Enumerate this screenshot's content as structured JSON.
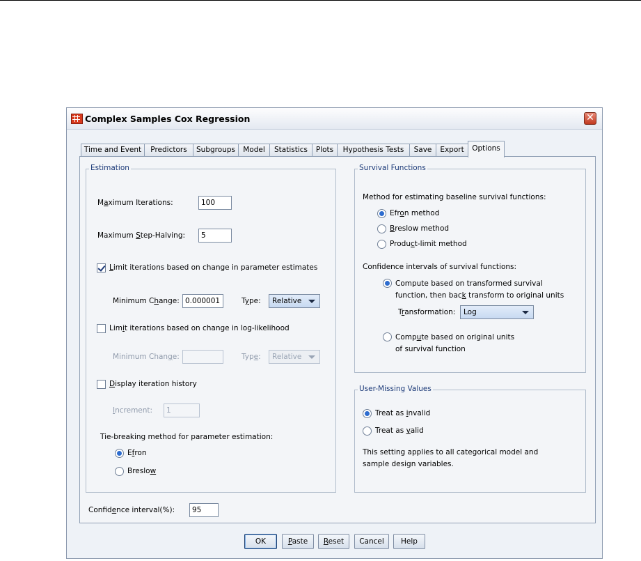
{
  "dialog": {
    "title": "Complex Samples Cox Regression",
    "close_glyph": "✕"
  },
  "tabs": [
    {
      "label": "Time and Event"
    },
    {
      "label": "Predictors"
    },
    {
      "label": "Subgroups"
    },
    {
      "label": "Model"
    },
    {
      "label": "Statistics"
    },
    {
      "label": "Plots"
    },
    {
      "label": "Hypothesis Tests"
    },
    {
      "label": "Save"
    },
    {
      "label": "Export"
    },
    {
      "label": "Options",
      "active": true
    }
  ],
  "estimation": {
    "title": "Estimation",
    "max_iterations_label_pre": "M",
    "max_iterations_label_key": "a",
    "max_iterations_label_post": "ximum Iterations:",
    "max_iterations_value": "100",
    "max_step_halving_label_pre": "Maximum ",
    "max_step_halving_label_key": "S",
    "max_step_halving_label_post": "tep-Halving:",
    "max_step_halving_value": "5",
    "limit_param_label_pre": "",
    "limit_param_label_key": "L",
    "limit_param_label_post": "imit iterations based on change in parameter estimates",
    "limit_param_checked": true,
    "min_change_label_pre": "Minimum C",
    "min_change_label_key": "h",
    "min_change_label_post": "ange:",
    "min_change_value": "0.000001",
    "type_label_pre": "T",
    "type_label_key": "y",
    "type_label_post": "pe:",
    "type_value": "Relative",
    "limit_loglik_label_pre": "Lim",
    "limit_loglik_label_key": "i",
    "limit_loglik_label_post": "t iterations based on change in log-likelihood",
    "limit_loglik_checked": false,
    "min_change2_label_pre": "Minimum Chan",
    "min_change2_label_key": "g",
    "min_change2_label_post": "e:",
    "min_change2_value": "",
    "type2_label_pre": "Typ",
    "type2_label_key": "e",
    "type2_label_post": ":",
    "type2_value": "Relative",
    "display_history_label_pre": "",
    "display_history_label_key": "D",
    "display_history_label_post": "isplay iteration history",
    "display_history_checked": false,
    "increment_label_pre": "",
    "increment_label_key": "I",
    "increment_label_post": "ncrement:",
    "increment_value": "1",
    "tie_label": "Tie-breaking method for parameter estimation:",
    "tie_efron_pre": "E",
    "tie_efron_key": "f",
    "tie_efron_post": "ron",
    "tie_breslow_pre": "Breslo",
    "tie_breslow_key": "w",
    "tie_breslow_post": "",
    "tie_selected": "Efron"
  },
  "survival": {
    "title": "Survival Functions",
    "method_label": "Method for estimating baseline survival functions:",
    "efron_pre": "Efr",
    "efron_key": "o",
    "efron_post": "n method",
    "breslow_pre": "",
    "breslow_key": "B",
    "breslow_post": "reslow method",
    "product_pre": "Produ",
    "product_key": "c",
    "product_post": "t-limit method",
    "method_selected": "Efron method",
    "ci_label": "Confidence intervals of survival functions:",
    "ci_transformed_line1": "Compute based on transformed survival",
    "ci_transformed_line2_pre": "function, then bac",
    "ci_transformed_line2_key": "k",
    "ci_transformed_line2_post": " transform to original units",
    "transformation_label_pre": "T",
    "transformation_label_key": "r",
    "transformation_label_post": "ansformation:",
    "transformation_value": "Log",
    "ci_original_line1_pre": "Comp",
    "ci_original_line1_key": "u",
    "ci_original_line1_post": "te based on original units",
    "ci_original_line2": "of survival function",
    "ci_selected": "transformed"
  },
  "user_missing": {
    "title": "User-Missing Values",
    "invalid_pre": "Treat as ",
    "invalid_key": "i",
    "invalid_post": "nvalid",
    "valid_pre": "Treat as ",
    "valid_key": "v",
    "valid_post": "alid",
    "selected": "invalid",
    "note_line1": "This setting applies to all categorical model and",
    "note_line2": "sample design variables."
  },
  "confidence": {
    "label_pre": "Confid",
    "label_key": "e",
    "label_post": "nce interval(%):",
    "value": "95"
  },
  "buttons": {
    "ok": "OK",
    "paste_key": "P",
    "paste_post": "aste",
    "reset_key": "R",
    "reset_post": "eset",
    "cancel": "Cancel",
    "help": "Help"
  }
}
